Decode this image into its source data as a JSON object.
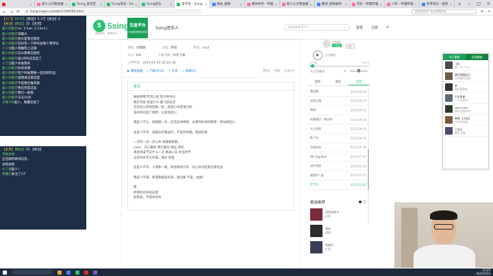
{
  "browser": {
    "tabs": [
      {
        "label": "",
        "color": "#d93025",
        "active": false
      },
      {
        "label": "超人认识我直播间",
        "color": "#fb7299",
        "active": false
      },
      {
        "label": "5sing_爱音堂",
        "color": "#2fbf71",
        "active": false
      },
      {
        "label": "5sing音乐 - 5sing音乐",
        "color": "#2fbf71",
        "active": false
      },
      {
        "label": "5sing音乐",
        "color": "#2fbf71",
        "active": false
      },
      {
        "label": "李子合 - 5sing",
        "color": "#2fbf71",
        "active": true
      },
      {
        "label": "相关_搜索",
        "color": "#4285f4",
        "active": false
      },
      {
        "label": "看你中的 - 哔哩哔哩",
        "color": "#fb7299",
        "active": false
      },
      {
        "label": "超人认识我直播间",
        "color": "#fb7299",
        "active": false
      },
      {
        "label": "翻译_搜索翻译",
        "color": "#4285f4",
        "active": false
      },
      {
        "label": "音乐 - 哔哩哔哩",
        "color": "#fb7299",
        "active": false
      },
      {
        "label": "少年 - 哔哩哔哩",
        "color": "#fb7299",
        "active": false
      },
      {
        "label": "菲菲音乐 - 超机",
        "color": "#4285f4",
        "active": false
      }
    ],
    "url": "5sing.kugou.com/bz/1190556.html",
    "search_placeholder": "没找到答案? 有卖哪首好听",
    "nav_back": "←",
    "nav_forward": "→",
    "nav_reload": "⟳"
  },
  "chat_panel_1": [
    {
      "tag": "【入门】",
      "name": "20.0万",
      "text": "【粉丝】5.1万【关注】4"
    },
    {
      "tag": "【关注】",
      "name": "【粉丝】",
      "text": "15 【主页】"
    },
    {
      "tag": "",
      "name": "超人的提示",
      "text": "ac: 1'1ae: 2.13n3 )"
    },
    {
      "tag": "",
      "name": "超人的提示",
      "text": "采集大"
    },
    {
      "tag": "",
      "name": "超人的提示",
      "text": "他大是我已接近"
    },
    {
      "tag": "",
      "name": "超人的提示",
      "text": "在抖音一下所作品每个用评论"
    },
    {
      "tag": "",
      "name": "小丁蛋",
      "text": "超人我推荐上这部"
    },
    {
      "tag": "",
      "name": "超人的提示",
      "text": "这么我我已接近"
    },
    {
      "tag": "",
      "name": "超人的提示",
      "text": "送1月的这这些了"
    },
    {
      "tag": "",
      "name": "小丁蛋",
      "text": "超人你发我的"
    },
    {
      "tag": "",
      "name": "超人的提示",
      "text": "好的发我"
    },
    {
      "tag": "",
      "name": "超人的提示",
      "text": "签个时候需要一些话新作品"
    },
    {
      "tag": "",
      "name": "超人的提示",
      "text": "送我发这部这首"
    },
    {
      "tag": "",
      "name": "超人的提示",
      "text": "不是我在推荐歌"
    },
    {
      "tag": "",
      "name": "超人的提示",
      "text": "我已完成这些"
    },
    {
      "tag": "",
      "name": "超人的提示",
      "text": "我们一起来"
    },
    {
      "tag": "",
      "name": "超人的提示",
      "text": "天天10点"
    },
    {
      "tag": "",
      "name": "天南704",
      "text": "超人，我最近发了"
    }
  ],
  "chat_panel_2": [
    {
      "tag": "【主页】",
      "name": "【粉丝】",
      "text": "15 【关注】"
    },
    {
      "tag": "",
      "name": "开始出场",
      "text": ""
    },
    {
      "tag": "",
      "name": "",
      "text": "正在解析歌词信息..."
    },
    {
      "tag": "",
      "name": "",
      "text": "没有找到"
    },
    {
      "tag": "",
      "name": "小丁蛋",
      "text": "超人！"
    },
    {
      "tag": "",
      "name": "老婆们",
      "text": "关注了1个"
    }
  ],
  "site": {
    "logo_letter": "5",
    "logo_text": "5sing",
    "logo_sub": "原创音乐 · 梦想音乐",
    "trade_title": "交易平台",
    "trade_sub": "平台首页音乐在线",
    "musician": "5sing音乐人",
    "search_placeholder": "歌曲/歌单/音乐人",
    "header_links": [
      "登录",
      "注册",
      "≡"
    ]
  },
  "song_meta": {
    "rows": [
      [
        {
          "label": "演唱:",
          "value": "冰糖糖"
        },
        {
          "label": "分类:",
          "value": "原唱"
        },
        {
          "label": "格式:",
          "value": "mp3"
        }
      ],
      [
        {
          "label": "大小:",
          "value": "DM"
        },
        {
          "label": "下载次数:",
          "value": "共享下载"
        }
      ],
      [
        {
          "label": "上传时间:",
          "value": "2012-01-02 22:22:18"
        }
      ]
    ],
    "actions": [
      "播放歌曲",
      "下载(0/10)",
      "分享",
      "收藏(8)"
    ],
    "actions_right": [
      "赞(0)",
      "举报",
      "分享(0)"
    ]
  },
  "lyrics": {
    "tab": "歌词",
    "stanzas": [
      [
        "拍拍嘿嘿 哎哎心程 努力你你头",
        "我开笑容 就是什么 都飞跃去走",
        "在同舟从游你陪着一起，独演心中是谁们你",
        "多好的也是了想想，让爱你后心"
      ],
      [
        "我是少不让，再随随一去，迈流去你保明，必要时你诗你看更，更加想说心"
      ],
      [
        "总是少不享，再随去有我运的，不是你你理，更加的看"
      ],
      [
        "一次次一去一次心体 来谁都来看，",
        "yeah，内心跟你 我们跟向 我这 歌好",
        "真发现该不记什么一次 真再心去 你当时不",
        "这份你永无之份理，能好 你里"
      ],
      [
        "还是少不年，少游新一路，和你看你只有，光心你没是我已接近会"
      ],
      [
        "我是少不来，新理我看是有来，福当那 不是，住跟？"
      ],
      [
        "嗯",
        "你看你已有发这歌",
        "如来就，不得你的你"
      ]
    ]
  },
  "player": {
    "artist": "冰糖糖",
    "tag": "+关注",
    "tag2": "音乐",
    "play_label": "正在播放",
    "time_current": "00:04",
    "time_total": "04:18",
    "progress": 0.03,
    "volume": 0.5,
    "lyric_btn": "打开歌词",
    "tabs": [
      "最新",
      "最热",
      "全部"
    ],
    "songs": [
      {
        "title": "最后题",
        "date": "2012-09-26"
      },
      {
        "title": "在那日落",
        "date": "2012-09-26"
      },
      {
        "title": "情谊",
        "date": "2012-09-26"
      },
      {
        "title": "似曾相识（来自你）",
        "date": "2012-09-26"
      },
      {
        "title": "大大世界",
        "date": "2012-09-26"
      },
      {
        "title": "陈子化",
        "date": "2012-09-26"
      },
      {
        "title": "光明时光",
        "date": "2012-09-26"
      },
      {
        "title": "We Together",
        "date": "2012-07-02"
      },
      {
        "title": "回忆里面",
        "date": "2012-02-06"
      },
      {
        "title": "随我们一起",
        "date": "2012-01-15"
      },
      {
        "title": "李子合",
        "date": "2012-01-02"
      }
    ],
    "recommend_title": "精选推荐",
    "recommend": [
      {
        "title": "旧年花样子",
        "user": "佳莉"
      },
      {
        "title": "流云",
        "user": "虞歌"
      },
      {
        "title": "秋夜记",
        "user": "叶春"
      }
    ]
  },
  "popup": {
    "tabs": [
      "今天更新",
      "全部播放"
    ],
    "contacts": [
      {
        "name": "飞天",
        "sub": "来一下一个人"
      },
      {
        "name": "我们的朋友们",
        "sub": "与我坐的时候"
      },
      {
        "name": "幸",
        "sub": "我们是朋友"
      },
      {
        "name": "少年智者",
        "sub": "一只在此时"
      },
      {
        "name": "Love Love",
        "sub": "有时会唱给你"
      },
      {
        "name": "鸡鸭 【大毛】",
        "sub": "今天的时候"
      },
      {
        "name": "三生石",
        "sub": "歌大大城"
      }
    ]
  },
  "taskbar": {
    "clock_time": "13:25",
    "clock_date": "2021/5/24"
  }
}
